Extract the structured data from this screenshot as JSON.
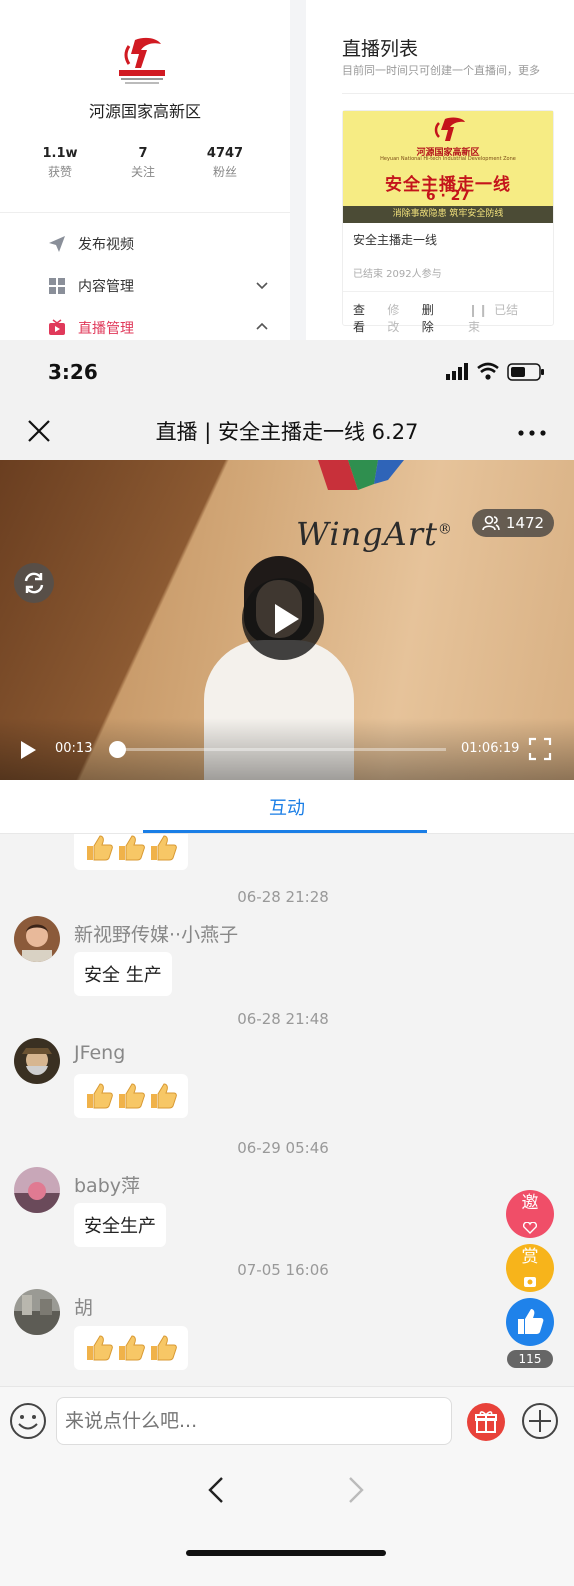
{
  "admin": {
    "org_name": "河源国家高新区",
    "stats": [
      {
        "value": "1.1w",
        "label": "获赞"
      },
      {
        "value": "7",
        "label": "关注"
      },
      {
        "value": "4747",
        "label": "粉丝"
      }
    ],
    "menu": [
      {
        "label": "发布视频",
        "icon": "send-icon"
      },
      {
        "label": "内容管理",
        "icon": "grid-icon"
      },
      {
        "label": "直播管理",
        "icon": "tv-icon"
      }
    ],
    "live_list": {
      "title": "直播列表",
      "subtitle": "目前同一时间只可创建一个直播间，更多",
      "card": {
        "poster": {
          "org": "河源国家高新区",
          "org_en": "Heyuan National Hi-tech Industrial Development Zone",
          "title": "安全主播走一线",
          "date": "6 · 27",
          "slogan": "消除事故隐患  筑牢安全防线"
        },
        "name": "安全主播走一线",
        "meta": "已结束 2092人参与",
        "actions": {
          "view": "查看",
          "edit": "修改",
          "delete": "删除",
          "status": "已结束"
        }
      }
    }
  },
  "status_bar": {
    "time": "3:26"
  },
  "nav": {
    "title": "直播 | 安全主播走一线 6.27"
  },
  "video": {
    "brand": "WingArt",
    "brand_mark": "®",
    "viewer_count": "1472",
    "current_time": "00:13",
    "total_time": "01:06:19",
    "progress": 0.003
  },
  "tab": {
    "label": "互动"
  },
  "chat": {
    "messages": [
      {
        "timestamp": "06-28 21:28",
        "user": "新视野传媒··小燕子",
        "text": "安全 生产"
      },
      {
        "timestamp": "06-28 21:48",
        "user": "JFeng",
        "thumbs": 3
      },
      {
        "timestamp": "06-29 05:46",
        "user": "baby萍",
        "text": "安全生产"
      },
      {
        "timestamp": "07-05 16:06",
        "user": "胡",
        "thumbs": 3
      }
    ],
    "fabs": {
      "invite": "邀",
      "reward": "赏",
      "like_count": "115"
    }
  },
  "input": {
    "placeholder": "来说点什么吧..."
  },
  "colors": {
    "accent": "#1a7ee6",
    "like": "#1f82ea",
    "invite": "#f04e68",
    "reward": "#f7b41b",
    "gift": "#e8423a",
    "menu_active": "#e0395a"
  }
}
